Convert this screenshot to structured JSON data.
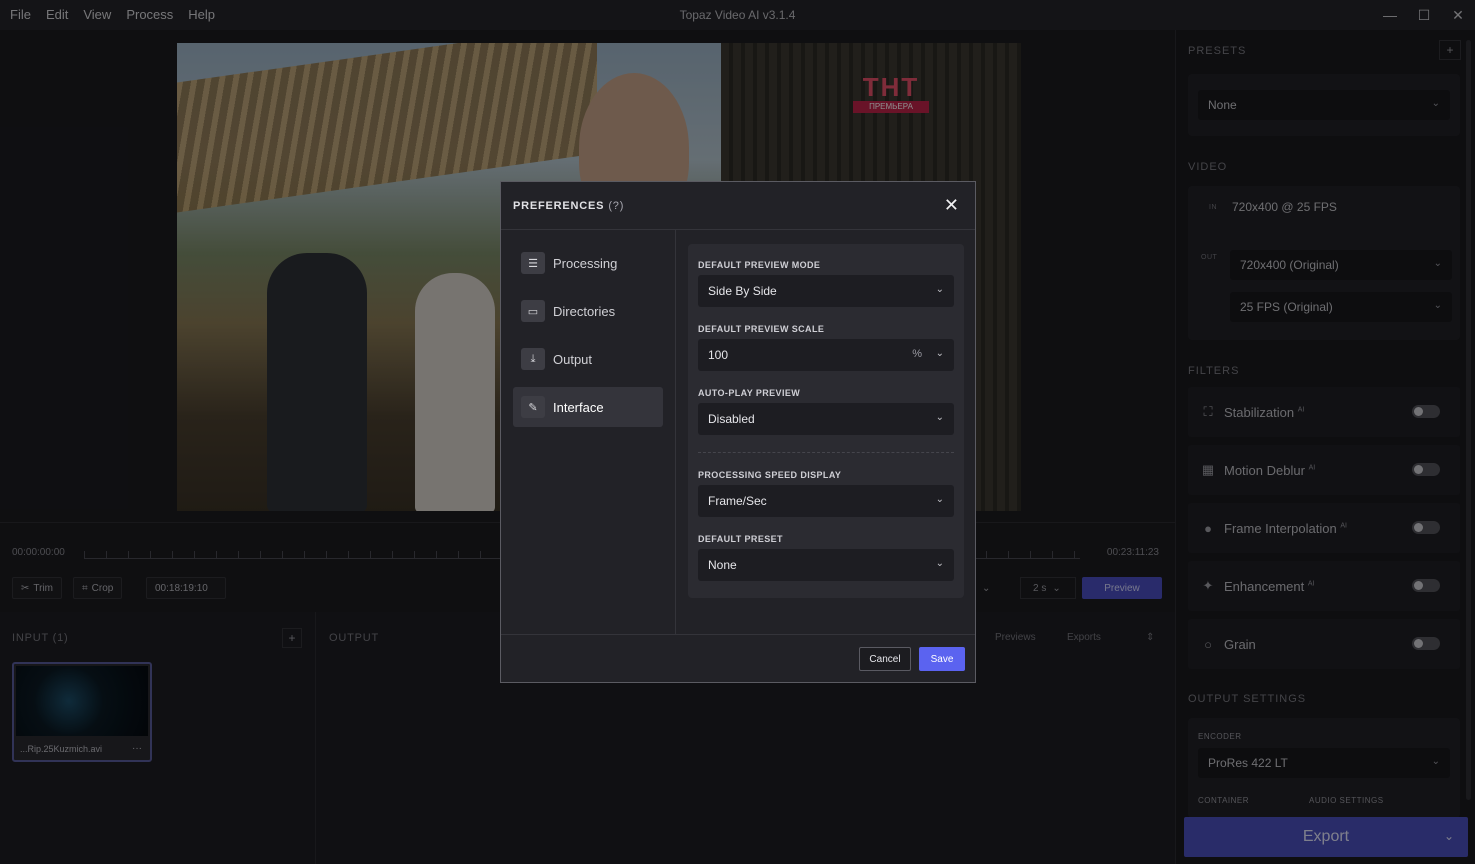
{
  "menu": [
    "File",
    "Edit",
    "View",
    "Process",
    "Help"
  ],
  "app_title": "Topaz Video AI  v3.1.4",
  "window_controls": {
    "minimize": "—",
    "maximize": "☐",
    "close": "✕"
  },
  "video": {
    "logo_text": "ТНТ",
    "logo_sub": "ПРЕМЬЕРА"
  },
  "timeline": {
    "start_tc": "00:00:00:00",
    "end_tc": "00:23:11:23",
    "trim_label": "Trim",
    "crop_label": "Crop",
    "current_tc": "00:18:19:10",
    "duration_value": "2 s",
    "preview_label": "Preview"
  },
  "input": {
    "header": "INPUT (1)",
    "add": "+",
    "file_name": "...Rip.25Kuzmich.avi",
    "more": "···"
  },
  "output": {
    "header": "OUTPUT",
    "tab_previews": "Previews",
    "tab_exports": "Exports"
  },
  "side": {
    "presets_header": "PRESETS",
    "presets_add": "+",
    "preset_value": "None",
    "video_header": "VIDEO",
    "in_tag": "IN",
    "in_value": "720x400 @ 25 FPS",
    "out_tag": "OUT",
    "out_res": "720x400 (Original)",
    "out_fps": "25 FPS (Original)",
    "filters_header": "FILTERS",
    "filters": [
      {
        "label": "Stabilization",
        "ai": "AI"
      },
      {
        "label": "Motion Deblur",
        "ai": "AI"
      },
      {
        "label": "Frame Interpolation",
        "ai": "AI"
      },
      {
        "label": "Enhancement",
        "ai": "AI"
      },
      {
        "label": "Grain",
        "ai": ""
      }
    ],
    "output_header": "OUTPUT SETTINGS",
    "encoder_label": "ENCODER",
    "encoder_value": "ProRes 422 LT",
    "container_label": "CONTAINER",
    "audio_label": "AUDIO SETTINGS",
    "export_label": "Export"
  },
  "modal": {
    "title": "PREFERENCES",
    "help": "(?)",
    "close": "✕",
    "nav": [
      {
        "label": "Processing",
        "icon": "sliders-icon"
      },
      {
        "label": "Directories",
        "icon": "folder-icon"
      },
      {
        "label": "Output",
        "icon": "download-icon"
      },
      {
        "label": "Interface",
        "icon": "edit-icon"
      }
    ],
    "active_nav": "Interface",
    "fields": {
      "preview_mode_label": "DEFAULT PREVIEW MODE",
      "preview_mode_value": "Side By Side",
      "preview_scale_label": "DEFAULT PREVIEW SCALE",
      "preview_scale_value": "100",
      "preview_scale_unit": "%",
      "autoplay_label": "AUTO-PLAY PREVIEW",
      "autoplay_value": "Disabled",
      "speed_label": "PROCESSING SPEED DISPLAY",
      "speed_value": "Frame/Sec",
      "preset_label": "DEFAULT PRESET",
      "preset_value": "None"
    },
    "cancel_label": "Cancel",
    "save_label": "Save"
  },
  "colors": {
    "accent": "#5b63f0",
    "export": "#4c50c0",
    "background": "#1b1b1f"
  }
}
